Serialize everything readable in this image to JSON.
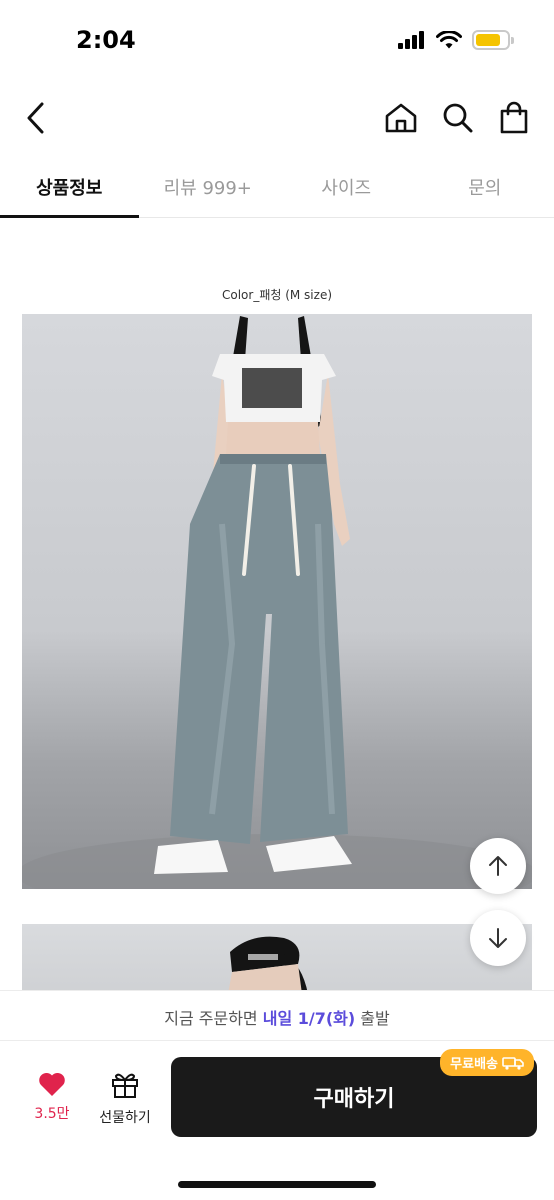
{
  "status_bar": {
    "time": "2:04"
  },
  "tabs": [
    {
      "label": "상품정보"
    },
    {
      "label": "리뷰 999+"
    },
    {
      "label": "사이즈"
    },
    {
      "label": "문의"
    }
  ],
  "content": {
    "caption": "Color_패청 (M size)"
  },
  "icons": {
    "back": "chevron-left-icon",
    "home": "home-icon",
    "search": "search-icon",
    "cart": "shopping-bag-icon",
    "scroll_up": "arrow-up-icon",
    "scroll_down": "arrow-down-icon",
    "like": "heart-icon",
    "gift": "gift-icon",
    "truck": "truck-icon"
  },
  "shipping": {
    "prefix": "지금 주문하면 ",
    "highlight": "내일 1/7(화)",
    "suffix": " 출발"
  },
  "bottom_bar": {
    "like_count": "3.5만",
    "gift_label": "선물하기",
    "buy_label": "구매하기",
    "free_shipping_badge": "무료배송"
  },
  "colors": {
    "accent_purple": "#5b4cdb",
    "heart_red": "#e0234c",
    "badge_orange": "#ffb42a",
    "buy_button": "#1a1a1a"
  }
}
